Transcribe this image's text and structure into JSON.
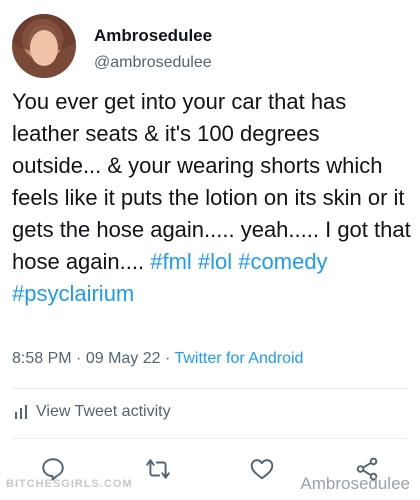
{
  "author": {
    "display_name": "Ambrosedulee",
    "handle": "@ambrosedulee"
  },
  "tweet": {
    "text_parts": [
      "You ever get into your car that has leather seats & it's 100 degrees outside... & your wearing shorts which feels like it puts the lotion on its skin or it gets the hose again..... yeah..... I got that hose again.... ",
      "#fml",
      " ",
      "#lol",
      " ",
      "#comedy",
      " ",
      "#psyclairium"
    ],
    "time": "8:58 PM",
    "date": "09 May 22",
    "separator": "·",
    "source": "Twitter for Android"
  },
  "activity": {
    "label": "View Tweet activity",
    "icon": "bar-chart-icon"
  },
  "actions": {
    "icons": [
      "reply-icon",
      "retweet-icon",
      "like-icon",
      "share-icon"
    ]
  },
  "watermarks": {
    "left": "BITCHESGIRLS.COM",
    "right": "Ambrosedulee"
  },
  "colors": {
    "link": "#1d9bf0",
    "secondary": "#536471",
    "text": "#0f1419"
  }
}
